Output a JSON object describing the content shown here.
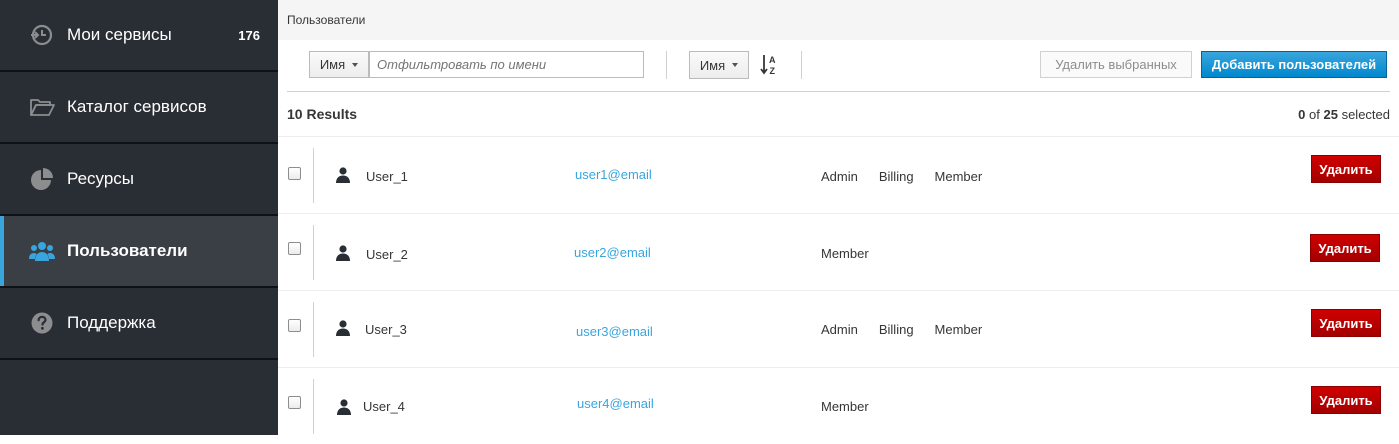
{
  "sidebar": {
    "items": [
      {
        "label": "Мои сервисы",
        "badge": "176",
        "icon": "services-icon",
        "active": false
      },
      {
        "label": "Каталог сервисов",
        "icon": "folder-open-icon",
        "active": false
      },
      {
        "label": "Ресурсы",
        "icon": "pie-chart-icon",
        "active": false
      },
      {
        "label": "Пользователи",
        "icon": "users-icon",
        "active": true
      },
      {
        "label": "Поддержка",
        "icon": "question-circle-icon",
        "active": false
      }
    ]
  },
  "breadcrumb": "Пользователи",
  "toolbar": {
    "filter_field": "Имя",
    "filter_placeholder": "Отфильтровать по имени",
    "sort_field": "Имя",
    "delete_selected_label": "Удалить выбранных",
    "add_users_label": "Добавить пользователей"
  },
  "results": {
    "count_label": "10 Results",
    "selected": "0",
    "of_label": "of",
    "total": "25",
    "selected_label": "selected"
  },
  "users": [
    {
      "name": "User_1",
      "email": "user1@email",
      "roles": [
        "Admin",
        "Billing",
        "Member"
      ],
      "delete_label": "Удалить"
    },
    {
      "name": "User_2",
      "email": "user2@email",
      "roles": [
        "Member"
      ],
      "delete_label": "Удалить"
    },
    {
      "name": "User_3",
      "email": "user3@email",
      "roles": [
        "Admin",
        "Billing",
        "Member"
      ],
      "delete_label": "Удалить"
    },
    {
      "name": "User_4",
      "email": "user4@email",
      "roles": [
        "Member"
      ],
      "delete_label": "Удалить"
    }
  ],
  "colors": {
    "sidebar_bg": "#292e34",
    "active_accent": "#39a5dc",
    "primary": "#0088ce",
    "danger": "#cc0000",
    "link": "#39a5dc"
  }
}
